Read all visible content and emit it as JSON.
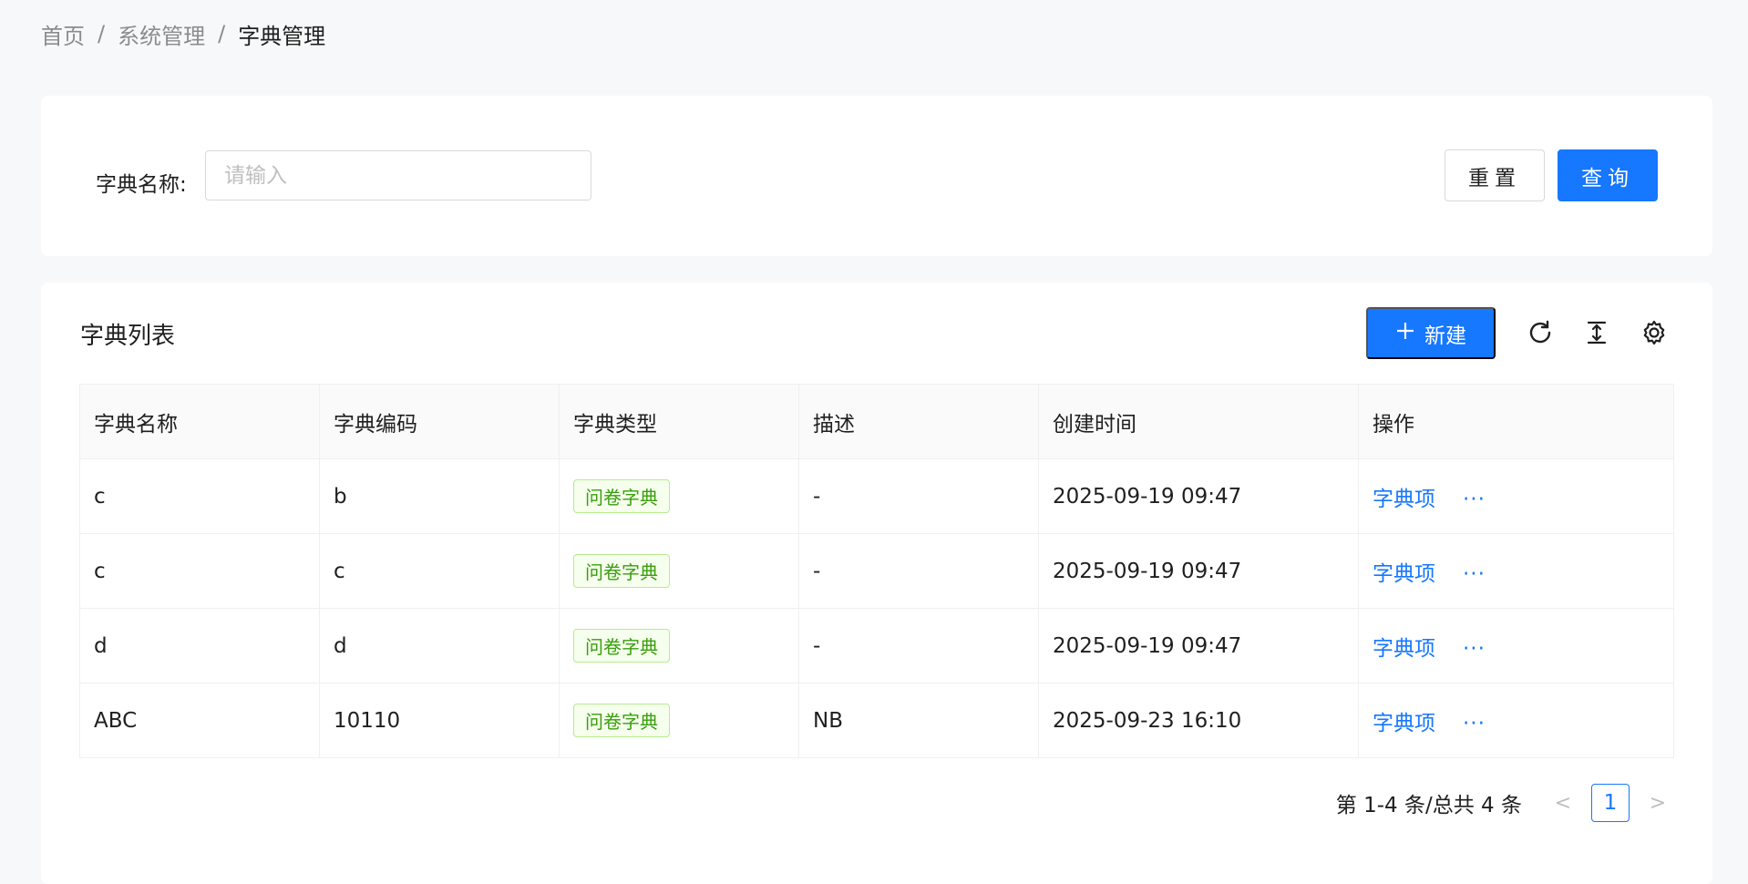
{
  "breadcrumb": {
    "items": [
      "首页",
      "系统管理",
      "字典管理"
    ],
    "separator": "/"
  },
  "search": {
    "label": "字典名称:",
    "placeholder": "请输入",
    "value": "",
    "reset_label": "重置",
    "query_label": "查询"
  },
  "list": {
    "title": "字典列表",
    "new_label": "新建",
    "columns": [
      "字典名称",
      "字典编码",
      "字典类型",
      "描述",
      "创建时间",
      "操作"
    ],
    "rows": [
      {
        "name": "c",
        "code": "b",
        "type": "问卷字典",
        "desc": "-",
        "created": "2025-09-19 09:47",
        "action": "字典项",
        "more": "···"
      },
      {
        "name": "c",
        "code": "c",
        "type": "问卷字典",
        "desc": "-",
        "created": "2025-09-19 09:47",
        "action": "字典项",
        "more": "···"
      },
      {
        "name": "d",
        "code": "d",
        "type": "问卷字典",
        "desc": "-",
        "created": "2025-09-19 09:47",
        "action": "字典项",
        "more": "···"
      },
      {
        "name": "ABC",
        "code": "10110",
        "type": "问卷字典",
        "desc": "NB",
        "created": "2025-09-23 16:10",
        "action": "字典项",
        "more": "···"
      }
    ]
  },
  "pagination": {
    "total_text": "第 1-4 条/总共 4 条",
    "current_page": "1",
    "prev": "<",
    "next": ">"
  },
  "colors": {
    "primary": "#1677ff",
    "tag_green": "#389e0d",
    "background": "#f7f8fa"
  },
  "icons": [
    "plus-icon",
    "refresh-icon",
    "density-icon",
    "settings-icon"
  ]
}
